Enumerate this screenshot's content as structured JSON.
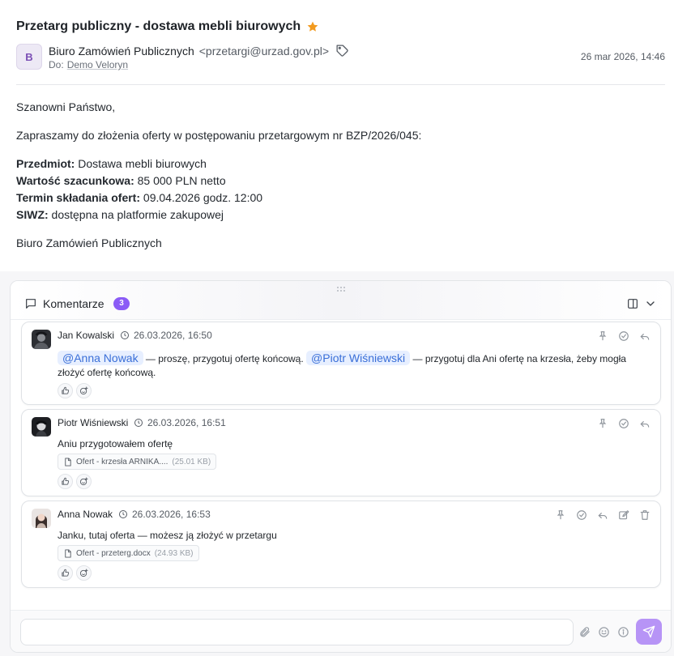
{
  "email": {
    "subject": "Przetarg publiczny - dostawa mebli biurowych",
    "starred": true,
    "sender_initial": "B",
    "sender_name": "Biuro Zamówień Publicznych",
    "sender_email": "<przetargi@urzad.gov.pl>",
    "to_label": "Do:",
    "to_name": "Demo Veloryn",
    "date": "26 mar 2026, 14:46",
    "greeting": "Szanowni Państwo,",
    "intro": "Zapraszamy do złożenia oferty w postępowaniu przetargowym nr BZP/2026/045:",
    "fields": [
      {
        "label": "Przedmiot:",
        "value": "Dostawa mebli biurowych"
      },
      {
        "label": "Wartość szacunkowa:",
        "value": "85 000 PLN netto"
      },
      {
        "label": "Termin składania ofert:",
        "value": "09.04.2026 godz. 12:00"
      },
      {
        "label": "SIWZ:",
        "value": "dostępna na platformie zakupowej"
      }
    ],
    "signature": "Biuro Zamówień Publicznych"
  },
  "comments_panel": {
    "title": "Komentarze",
    "count": "3",
    "accent_color": "#8b5cf6",
    "comments": [
      {
        "author": "Jan Kowalski",
        "time": "26.03.2026, 16:50",
        "mention1": "@Anna Nowak",
        "text1": " — proszę, przygotuj ofertę końcową. ",
        "mention2": "@Piotr Wiśniewski",
        "text2": " — przygotuj dla Ani ofertę na krzesła, żeby mogła złożyć ofertę końcową.",
        "actions": [
          "pin-icon",
          "check-circle-icon",
          "reply-icon"
        ]
      },
      {
        "author": "Piotr Wiśniewski",
        "time": "26.03.2026, 16:51",
        "text": "Aniu przygotowałem ofertę",
        "attachment_name": "Ofert - krzesła ARNIKA....",
        "attachment_size": "(25.01 KB)",
        "actions": [
          "pin-icon",
          "check-circle-icon",
          "reply-icon"
        ]
      },
      {
        "author": "Anna Nowak",
        "time": "26.03.2026, 16:53",
        "text": "Janku, tutaj oferta — możesz ją złożyć w przetargu",
        "attachment_name": "Ofert - przeterg.docx",
        "attachment_size": "(24.93 KB)",
        "actions": [
          "pin-icon",
          "check-circle-icon",
          "reply-icon",
          "edit-icon",
          "trash-icon"
        ]
      }
    ],
    "composer": {
      "placeholder": "",
      "send_color": "#b794f6"
    }
  }
}
